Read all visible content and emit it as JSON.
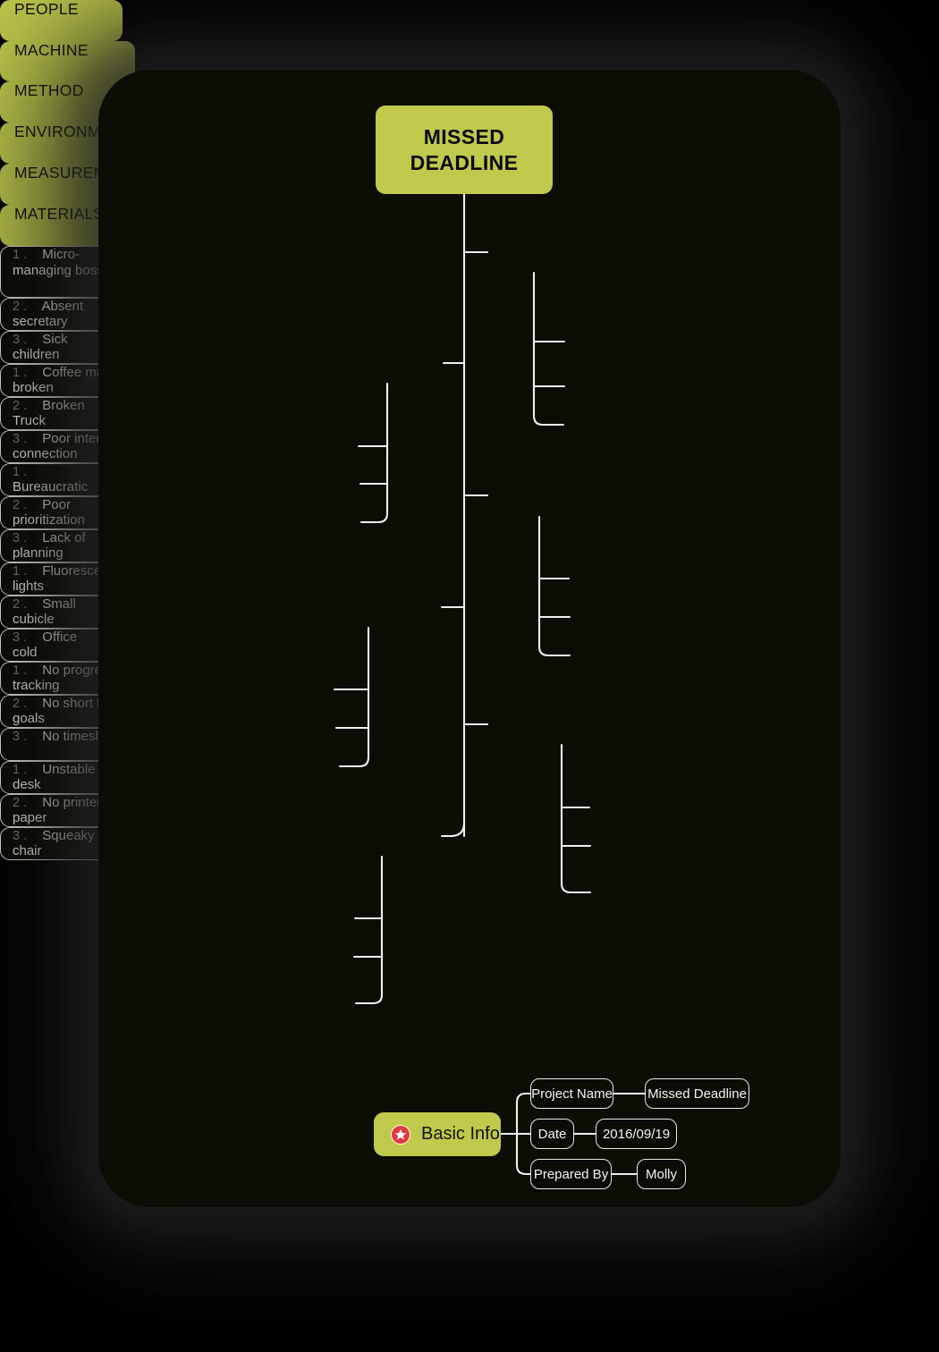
{
  "diagram": {
    "title": "MISSED DEADLINE",
    "type": "fishbone-mind-map",
    "root": {
      "label_line1": "MISSED",
      "label_line2": "DEADLINE"
    },
    "colors": {
      "accent_green": "#bfca4c",
      "canvas": "#0c0d04",
      "page_background": "#000000",
      "node_outline": "#e9e9e2",
      "leaf_text": "#f2f2ec",
      "number_text": "#7f8079",
      "star_red": "#e0393e"
    },
    "branches": [
      {
        "id": "people",
        "label": "PEOPLE",
        "side": "right",
        "children": [
          {
            "num": "1 .",
            "text": "Micro-managing boss"
          },
          {
            "num": "2 .",
            "text": "Absent secretary"
          },
          {
            "num": "3 .",
            "text": "Sick children"
          }
        ]
      },
      {
        "id": "machine",
        "label": "MACHINE",
        "side": "left",
        "children": [
          {
            "num": "1 .",
            "text": "Coffee machine broken"
          },
          {
            "num": "2 .",
            "text": "Broken Truck"
          },
          {
            "num": "3 .",
            "text": "Poor internet connection"
          }
        ]
      },
      {
        "id": "method",
        "label": "METHOD",
        "side": "right",
        "children": [
          {
            "num": "1 .",
            "text": "Bureaucratic"
          },
          {
            "num": "2 .",
            "text": "Poor prioritization"
          },
          {
            "num": "3 .",
            "text": "Lack of planning"
          }
        ]
      },
      {
        "id": "environment",
        "label": "ENVIRONMENT",
        "side": "left",
        "children": [
          {
            "num": "1 .",
            "text": "Fluorescent lights"
          },
          {
            "num": "2 .",
            "text": "Small cubicle"
          },
          {
            "num": "3 .",
            "text": "Office cold"
          }
        ]
      },
      {
        "id": "measurement",
        "label": "MEASUREMENT",
        "side": "right",
        "children": [
          {
            "num": "1 .",
            "text": "No progress tracking"
          },
          {
            "num": "2 .",
            "text": "No short term goals"
          },
          {
            "num": "3 .",
            "text": "No timesheet"
          }
        ]
      },
      {
        "id": "materials",
        "label": "MATERIALS",
        "side": "left",
        "children": [
          {
            "num": "1 .",
            "text": "Unstable desk"
          },
          {
            "num": "2 .",
            "text": "No printer paper"
          },
          {
            "num": "3 .",
            "text": "Squeaky desk chair"
          }
        ]
      }
    ],
    "basic_info": {
      "label": "Basic Info",
      "icon": "star-badge-icon",
      "rows": [
        {
          "key": "Project Name",
          "value": "Missed Deadline"
        },
        {
          "key": "Date",
          "value": "2016/09/19"
        },
        {
          "key": "Prepared By",
          "value": "Molly"
        }
      ]
    }
  }
}
